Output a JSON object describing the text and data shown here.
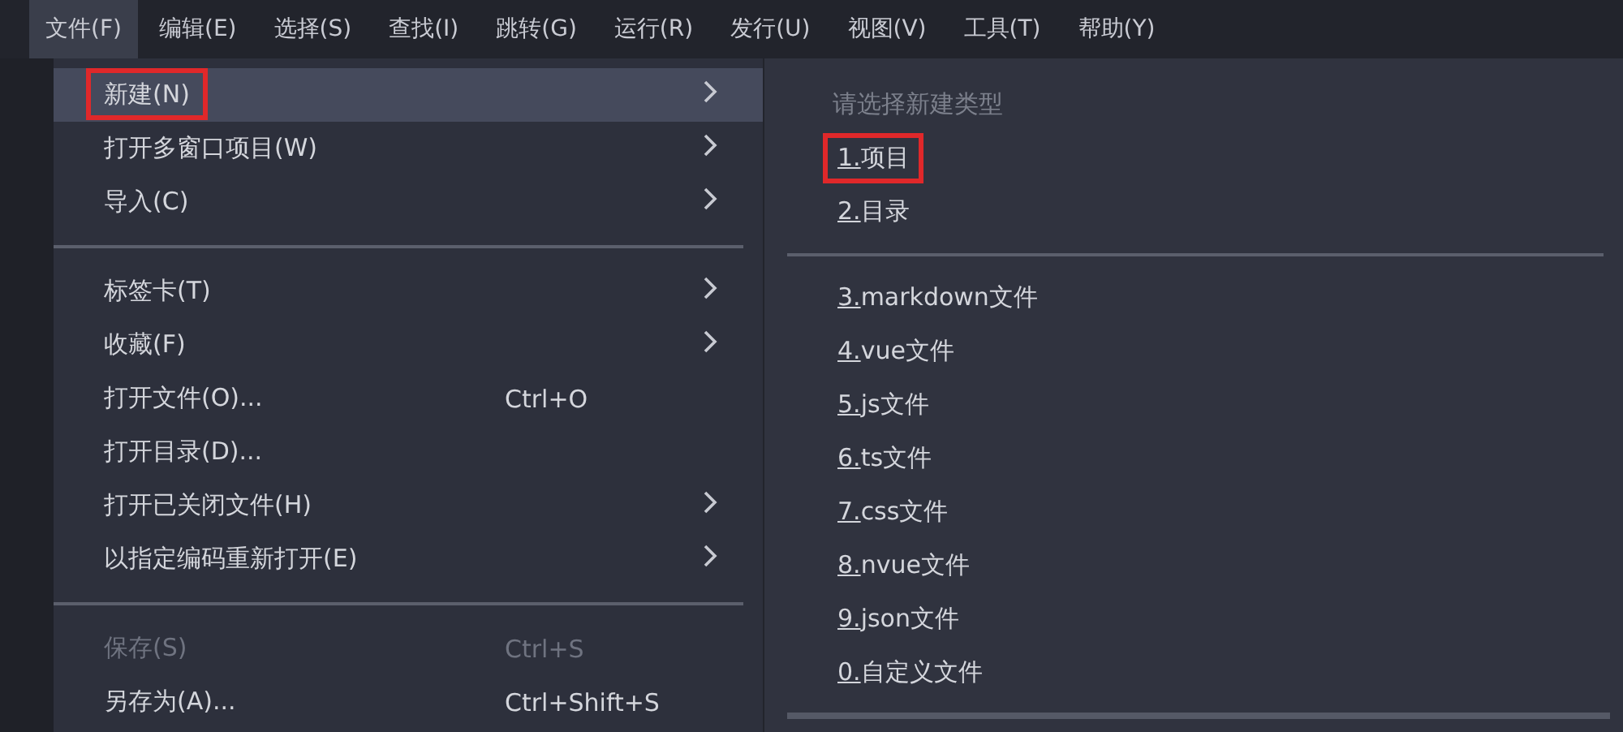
{
  "menubar": [
    {
      "label": "文件(F)",
      "selected": true
    },
    {
      "label": "编辑(E)",
      "selected": false
    },
    {
      "label": "选择(S)",
      "selected": false
    },
    {
      "label": "查找(I)",
      "selected": false
    },
    {
      "label": "跳转(G)",
      "selected": false
    },
    {
      "label": "运行(R)",
      "selected": false
    },
    {
      "label": "发行(U)",
      "selected": false
    },
    {
      "label": "视图(V)",
      "selected": false
    },
    {
      "label": "工具(T)",
      "selected": false
    },
    {
      "label": "帮助(Y)",
      "selected": false
    }
  ],
  "file_menu": {
    "items": [
      {
        "kind": "item",
        "label": "新建(N)",
        "submenu": true,
        "disabled": false,
        "selected": true,
        "highlighted": true
      },
      {
        "kind": "item",
        "label": "打开多窗口项目(W)",
        "submenu": true,
        "disabled": false,
        "selected": false,
        "highlighted": false
      },
      {
        "kind": "item",
        "label": "导入(C)",
        "submenu": true,
        "disabled": false,
        "selected": false,
        "highlighted": false
      },
      {
        "kind": "separator"
      },
      {
        "kind": "item",
        "label": "标签卡(T)",
        "submenu": true,
        "disabled": false,
        "selected": false,
        "highlighted": false
      },
      {
        "kind": "item",
        "label": "收藏(F)",
        "submenu": true,
        "disabled": false,
        "selected": false,
        "highlighted": false
      },
      {
        "kind": "item",
        "label": "打开文件(O)...",
        "shortcut": "Ctrl+O",
        "submenu": false,
        "disabled": false,
        "selected": false,
        "highlighted": false
      },
      {
        "kind": "item",
        "label": "打开目录(D)...",
        "submenu": false,
        "disabled": false,
        "selected": false,
        "highlighted": false
      },
      {
        "kind": "item",
        "label": "打开已关闭文件(H)",
        "submenu": true,
        "disabled": false,
        "selected": false,
        "highlighted": false
      },
      {
        "kind": "item",
        "label": "以指定编码重新打开(E)",
        "submenu": true,
        "disabled": false,
        "selected": false,
        "highlighted": false
      },
      {
        "kind": "separator"
      },
      {
        "kind": "item",
        "label": "保存(S)",
        "shortcut": "Ctrl+S",
        "submenu": false,
        "disabled": true,
        "selected": false,
        "highlighted": false
      },
      {
        "kind": "item",
        "label": "另存为(A)...",
        "shortcut": "Ctrl+Shift+S",
        "submenu": false,
        "disabled": false,
        "selected": false,
        "highlighted": false
      }
    ]
  },
  "new_submenu": {
    "items": [
      {
        "kind": "heading",
        "label": "请选择新建类型"
      },
      {
        "kind": "item",
        "label": "1.项目",
        "highlighted": true
      },
      {
        "kind": "item",
        "label": "2.目录",
        "highlighted": false
      },
      {
        "kind": "separator"
      },
      {
        "kind": "item",
        "label": "3.markdown文件",
        "highlighted": false
      },
      {
        "kind": "item",
        "label": "4.vue文件",
        "highlighted": false
      },
      {
        "kind": "item",
        "label": "5.js文件",
        "highlighted": false
      },
      {
        "kind": "item",
        "label": "6.ts文件",
        "highlighted": false
      },
      {
        "kind": "item",
        "label": "7.css文件",
        "highlighted": false
      },
      {
        "kind": "item",
        "label": "8.nvue文件",
        "highlighted": false
      },
      {
        "kind": "item",
        "label": "9.json文件",
        "highlighted": false
      },
      {
        "kind": "item",
        "label": "0.自定义文件",
        "highlighted": false
      }
    ]
  }
}
